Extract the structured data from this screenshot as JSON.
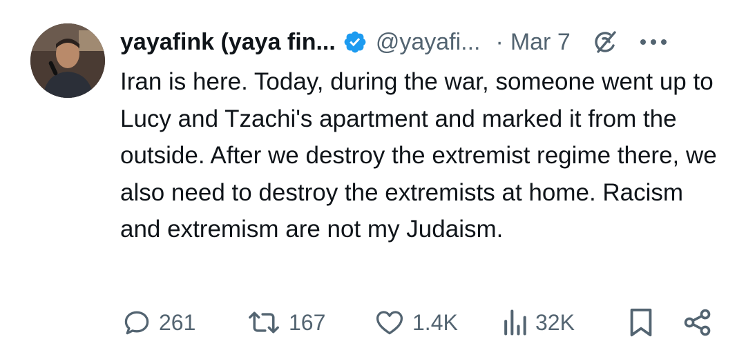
{
  "author": {
    "display_name": "yayafink (yaya fin...",
    "handle": "@yayafi...",
    "separator": "·",
    "date": "Mar 7"
  },
  "icons": {
    "verified": "verified-badge-icon",
    "grok": "grok-icon",
    "more": "more-options-icon",
    "reply": "reply-icon",
    "repost": "repost-icon",
    "like": "like-icon",
    "views": "views-icon",
    "bookmark": "bookmark-icon",
    "share": "share-icon"
  },
  "colors": {
    "verified_blue": "#1d9bf0",
    "text_primary": "#0f1419",
    "text_secondary": "#536471"
  },
  "tweet": {
    "text": "Iran is here. Today, during the war, someone went up to Lucy and Tzachi's apartment and marked it from the outside. After we destroy the extremist regime there, we also need to destroy the extremists at home. Racism and extremism are not my Judaism."
  },
  "metrics": {
    "replies": "261",
    "reposts": "167",
    "likes": "1.4K",
    "views": "32K"
  }
}
